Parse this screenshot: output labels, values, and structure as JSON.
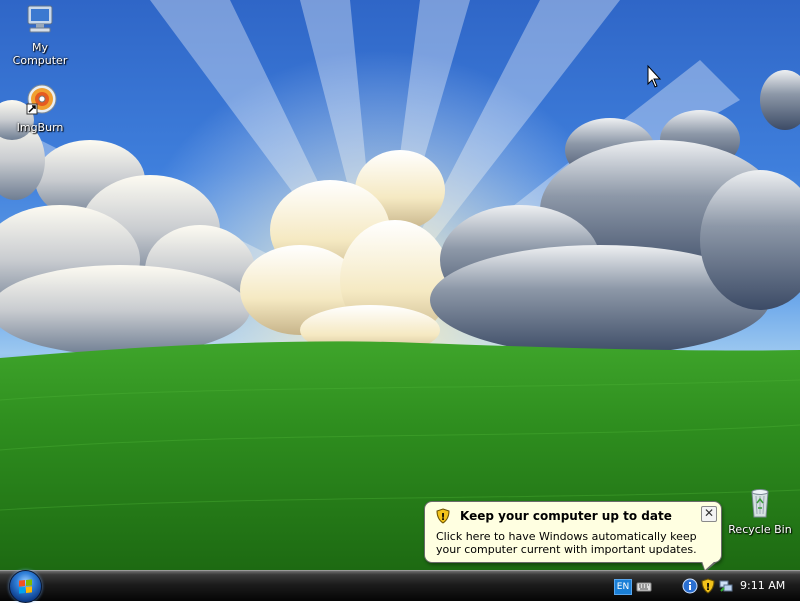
{
  "desktop": {
    "icons": [
      {
        "label": "My\nComputer",
        "icon": "computer-icon"
      },
      {
        "label": "ImgBurn",
        "icon": "imgburn-disc-icon"
      },
      {
        "label": "Recycle Bin",
        "icon": "recycle-bin-icon"
      }
    ]
  },
  "balloon": {
    "title": "Keep your computer up to date",
    "text": "Click here to have Windows automatically keep your computer current with important updates.",
    "icon": "security-shield-icon",
    "close": "✕"
  },
  "taskbar": {
    "start_icon": "windows-orb-icon",
    "language": "EN",
    "tray_icons": [
      "keyboard-icon",
      "info-icon",
      "security-shield-icon",
      "network-icon"
    ],
    "clock": "9:11 AM"
  },
  "colors": {
    "balloon_bg": "#ffffe1",
    "taskbar": "#1c1c1c",
    "language_badge": "#1a7fd6"
  }
}
